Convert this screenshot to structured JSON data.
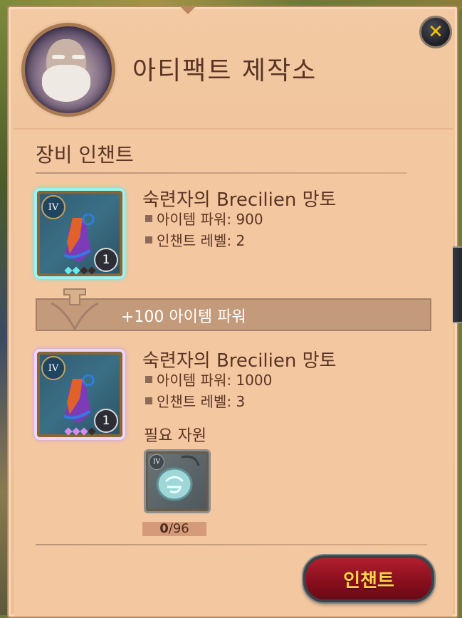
{
  "header": {
    "title": "아티팩트 제작소",
    "close_icon": "close-icon"
  },
  "section": {
    "title": "장비 인챈트"
  },
  "current_item": {
    "name": "숙련자의 Brecilien 망토",
    "tier": "IV",
    "quantity": "1",
    "power_label": "아이템 파워: 900",
    "enchant_label": "인챈트 레벨: 2",
    "glow_color": "#68e3e6"
  },
  "upgrade": {
    "banner_text": "+100 아이템 파워"
  },
  "result_item": {
    "name": "숙련자의 Brecilien 망토",
    "tier": "IV",
    "quantity": "1",
    "power_label": "아이템 파워: 1000",
    "enchant_label": "인챈트 레벨: 3",
    "glow_color": "#c89bf0"
  },
  "requirements": {
    "label": "필요 자원",
    "resource": {
      "tier": "IV",
      "icon": "rune-pendant-icon",
      "have": "0",
      "need": "/96"
    }
  },
  "actions": {
    "enchant_label": "인챈트",
    "accent": "#b21f2f"
  }
}
